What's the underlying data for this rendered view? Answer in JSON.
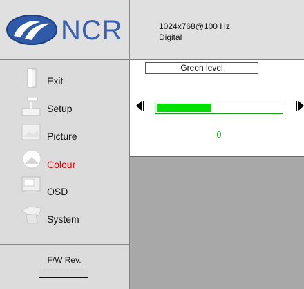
{
  "header": {
    "logo_text": "NCR",
    "resolution": "1024x768@100 Hz",
    "signal": "Digital"
  },
  "sidebar": {
    "items": [
      {
        "label": "Exit",
        "icon": "door-icon"
      },
      {
        "label": "Setup",
        "icon": "setup-icon"
      },
      {
        "label": "Picture",
        "icon": "picture-icon"
      },
      {
        "label": "Colour",
        "icon": "colour-icon",
        "active": true
      },
      {
        "label": "OSD",
        "icon": "osd-icon"
      },
      {
        "label": "System",
        "icon": "system-icon"
      }
    ],
    "fw_label": "F/W Rev.",
    "fw_value": ""
  },
  "panel": {
    "title": "Green level",
    "value": "0",
    "level_fraction": 0.44
  },
  "colors": {
    "active_text": "#e00000",
    "level_fill": "#00e000",
    "value_text": "#22cc22",
    "logo_blue": "#3a5fb0"
  }
}
